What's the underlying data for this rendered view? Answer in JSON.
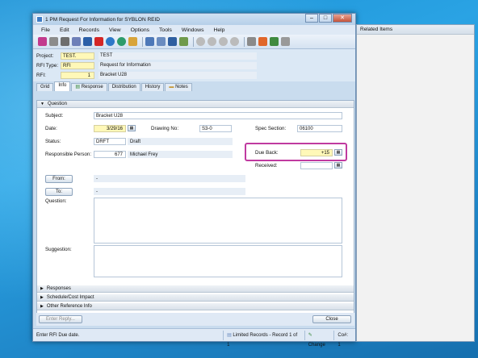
{
  "window": {
    "title": "1 PM Request For Information for SYBLON REID"
  },
  "menu": [
    "File",
    "Edit",
    "Records",
    "View",
    "Options",
    "Tools",
    "Windows",
    "Help"
  ],
  "header": {
    "project": {
      "label": "Project:",
      "code": "TEST.",
      "name": "TEST"
    },
    "rfi_type": {
      "label": "RFI Type:",
      "code": "RFI",
      "name": "Request for Information"
    },
    "rfi": {
      "label": "RFI:",
      "code": "1",
      "name": "Bracket U28"
    }
  },
  "tabs": [
    "Grid",
    "Info",
    "Response",
    "Distribution",
    "History",
    "Notes"
  ],
  "sections": {
    "question": "Question",
    "responses": "Responses",
    "schedule": "Schedule/Cost Impact",
    "other": "Other Reference Info"
  },
  "form": {
    "subject_label": "Subject:",
    "subject": "Bracket U28",
    "date_label": "Date:",
    "date": "3/29/16",
    "drawing_label": "Drawing No:",
    "drawing": "S3-0",
    "spec_label": "Spec Section:",
    "spec": "06100",
    "status_label": "Status:",
    "status_code": "DRFT",
    "status_name": "Draft",
    "resp_label": "Responsible Person:",
    "resp_code": "677",
    "resp_name": "Michael Frey",
    "dueback_label": "Due Back:",
    "dueback": "+15",
    "received_label": "Received:",
    "from_btn": "From:",
    "from_val": "-",
    "to_btn": "To:",
    "to_val": "-",
    "question_label": "Question:",
    "suggestion_label": "Suggestion:"
  },
  "buttons": {
    "enter_reply": "Enter Reply...",
    "close": "Close"
  },
  "status_bar": {
    "hint": "Enter RFI Due date.",
    "records": "Limited Records - Record 1 of 1",
    "change": "Change",
    "count": "Co#: 1"
  },
  "related": {
    "title": "Related Items"
  },
  "colors": {
    "highlight": "#c03aa0",
    "desktop": "#1f8fd4"
  }
}
